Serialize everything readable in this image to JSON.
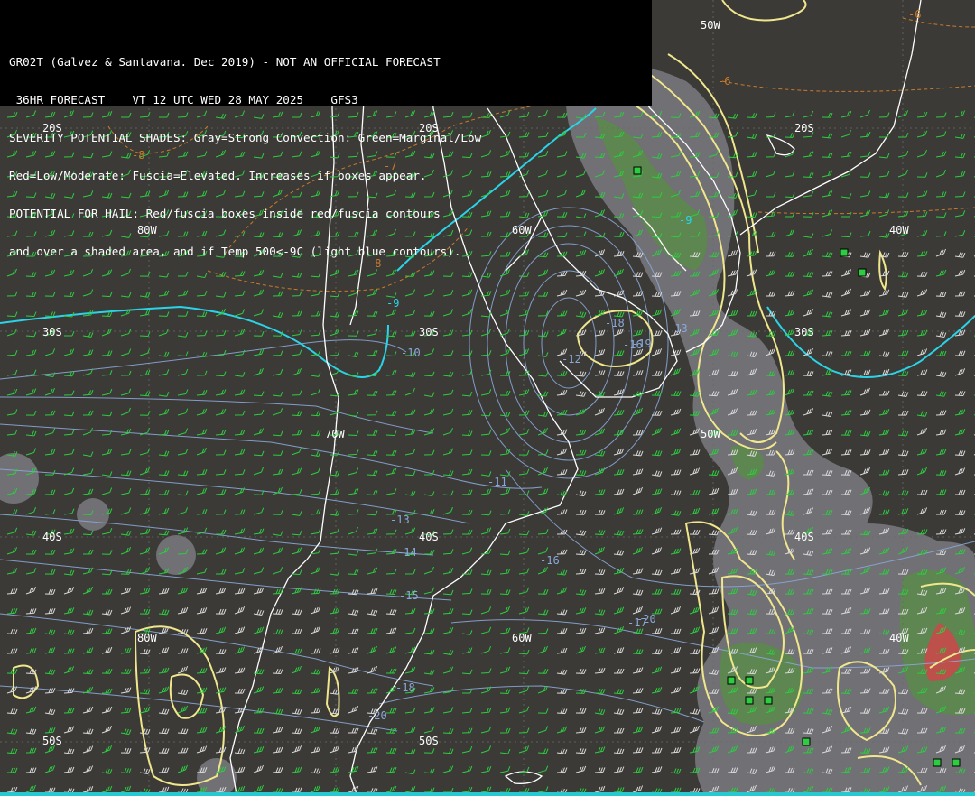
{
  "header": {
    "lines": [
      "GR02T (Galvez & Santavana. Dec 2019) - NOT AN OFFICIAL FORECAST",
      " 36HR FORECAST    VT 12 UTC WED 28 MAY 2025    GFS3",
      "SEVERITY POTENTIAL SHADES: Gray=Strong Convection: Green=Marginal/Low",
      "Red=Low/Moderate: Fuscia=Elevated. Increases if boxes appear.",
      "POTENTIAL FOR HAIL: Red/fuscia boxes inside red/fuscia contours",
      "and over a shaded area, and if Temp 500<-9C (light blue contours)."
    ]
  },
  "grid_labels": {
    "lat": [
      "20S",
      "20S",
      "20S",
      "30S",
      "30S",
      "30S",
      "40S",
      "40S",
      "40S",
      "50S",
      "50S"
    ],
    "lon": [
      "80W",
      "60W",
      "40W",
      "70W",
      "50W",
      "80W",
      "60W",
      "40W",
      "50W"
    ]
  },
  "temp_labels": [
    "-8",
    "-7",
    "-8",
    "-6",
    "-6",
    "-9",
    "-9",
    "-10",
    "-11",
    "-12",
    "-13",
    "-14",
    "-15",
    "-16",
    "-17",
    "-18",
    "-20",
    "-20",
    "-13",
    "-18",
    "-16",
    "-19"
  ],
  "colors": {
    "background": "#3b3a37",
    "header_bg": "#000000",
    "coast": "#ffffff",
    "yellow_contour": "#f0e68c",
    "cyan_line": "#2ad4e8",
    "temp_contour": "#8aa8d8",
    "wind_barb": "#2ecc40",
    "gray_shade": "#7a7a80",
    "green_shade": "#5a8a4a",
    "red_shade": "#c84a4a",
    "box": "#2ecc40",
    "orange_dashed": "#c87a2a"
  }
}
